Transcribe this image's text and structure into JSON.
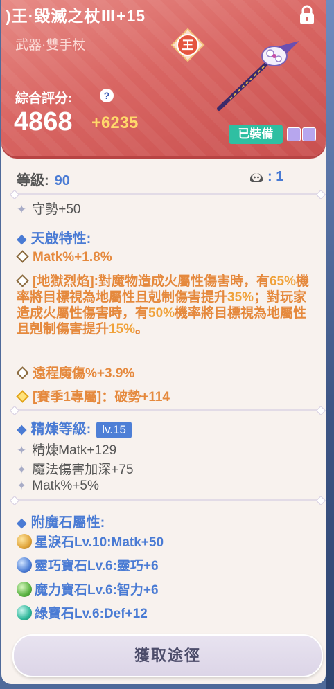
{
  "header": {
    "title": ")王·毀滅之杖Ⅲ+15",
    "subtype": "武器·雙手杖",
    "emblem_char": "王",
    "rating_label": "綜合評分:",
    "help_glyph": "?",
    "score": "4868",
    "score_bonus": "+6235",
    "equipped_label": "已裝備",
    "icons": [
      "lock-icon",
      "emblem-icon",
      "help-icon",
      "weapon-staff-image"
    ],
    "colors": {
      "header_bg": "#d96663",
      "bonus": "#ffd86b",
      "equipped": "#2fbfa2",
      "accent_blue": "#4a7bd4",
      "orange": "#e5893d"
    }
  },
  "level": {
    "label": "等級:",
    "value": "90",
    "pet_value": ": 1"
  },
  "stats": {
    "base_partial": "守勢+50",
    "talent_title": "天啟特性:",
    "talent_1": "Matk%+1.8%",
    "talent_2_parts": [
      "[地獄烈焰]:對魔物造成火屬性傷害時，有",
      "65%",
      "機率將目標視為地屬性且剋制傷害提升",
      "35%",
      "；對玩家造成火屬性傷害時，有",
      "50%",
      "機率將目標視為地屬性且剋制傷害提升",
      "15%",
      "。"
    ],
    "talent_3": "遠程魔傷%+3.9%",
    "talent_4": "[賽季1專屬]：破勢+114",
    "refine_title": "精煉等級:",
    "refine_level": "lv.15",
    "refine_lines": [
      "精煉Matk+129",
      "魔法傷害加深+75",
      "Matk%+5%"
    ],
    "enchant_title": "附魔石屬性:",
    "enchant_lines": [
      "星淚石Lv.10:Matk+50",
      "靈巧寶石Lv.6:靈巧+6",
      "魔力寶石Lv.6:智力+6",
      "綠寶石Lv.6:Def+12"
    ]
  },
  "footer": {
    "acquire_label": "獲取途徑"
  }
}
